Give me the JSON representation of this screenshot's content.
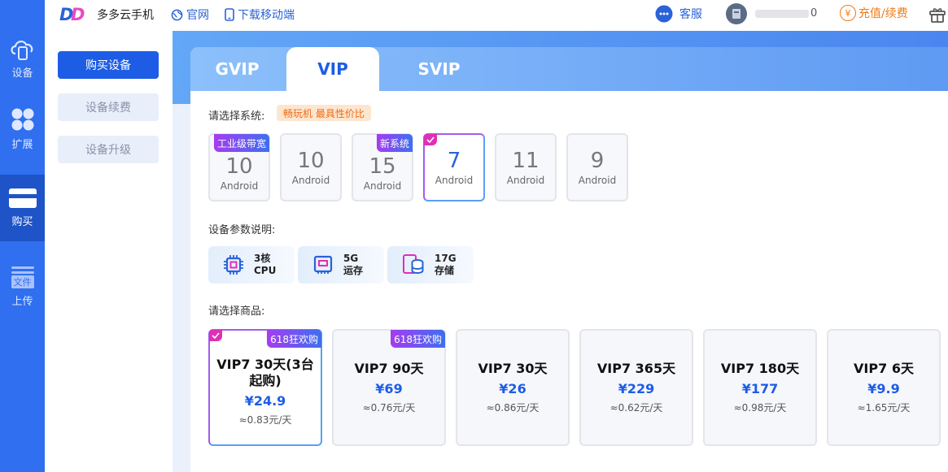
{
  "rail": {
    "items": [
      {
        "label": "设备",
        "icon": "cloud-phone-icon"
      },
      {
        "label": "扩展",
        "icon": "extension-grid-icon"
      },
      {
        "label": "购买",
        "icon": "card-icon",
        "active": true
      },
      {
        "label": "上传",
        "icon": "upload-file-icon",
        "badge": "文件"
      }
    ]
  },
  "header": {
    "brand": "多多云手机",
    "official_site": "官网",
    "download_mobile": "下载移动端",
    "customer_service": "客服",
    "account_suffix": "0",
    "recharge": "充值/续费",
    "coin_symbol": "¥"
  },
  "submenu": {
    "buy_device": "购买设备",
    "renew_device": "设备续费",
    "upgrade_device": "设备升级"
  },
  "tabs": [
    "GVIP",
    "VIP",
    "SVIP"
  ],
  "system": {
    "label": "请选择系统:",
    "promo": "畅玩机 最具性价比",
    "options": [
      {
        "version": "10",
        "os": "Android",
        "badge": "工业级带宽"
      },
      {
        "version": "10",
        "os": "Android"
      },
      {
        "version": "15",
        "os": "Android",
        "badge": "新系统"
      },
      {
        "version": "7",
        "os": "Android",
        "selected": true
      },
      {
        "version": "11",
        "os": "Android"
      },
      {
        "version": "9",
        "os": "Android"
      }
    ]
  },
  "params": {
    "label": "设备参数说明:",
    "items": [
      {
        "value": "3核",
        "name": "CPU",
        "icon": "cpu-icon"
      },
      {
        "value": "5G",
        "name": "运存",
        "icon": "memory-icon"
      },
      {
        "value": "17G",
        "name": "存储",
        "icon": "storage-icon"
      }
    ]
  },
  "products": {
    "label": "请选择商品:",
    "items": [
      {
        "name": "VIP7 30天(3台起购)",
        "price": "¥24.9",
        "daily": "≈0.83元/天",
        "badge": "618狂欢购",
        "selected": true
      },
      {
        "name": "VIP7 90天",
        "price": "¥69",
        "daily": "≈0.76元/天",
        "badge": "618狂欢购"
      },
      {
        "name": "VIP7 30天",
        "price": "¥26",
        "daily": "≈0.86元/天"
      },
      {
        "name": "VIP7 365天",
        "price": "¥229",
        "daily": "≈0.62元/天"
      },
      {
        "name": "VIP7 180天",
        "price": "¥177",
        "daily": "≈0.98元/天"
      },
      {
        "name": "VIP7 6天",
        "price": "¥9.9",
        "daily": "≈1.65元/天"
      }
    ]
  },
  "colors": {
    "primary": "#1d5de6",
    "rail": "#2f6ff0",
    "accent_orange": "#f07a14",
    "badge_gradient_start": "#a63cf0",
    "badge_gradient_end": "#3c6ff0"
  }
}
